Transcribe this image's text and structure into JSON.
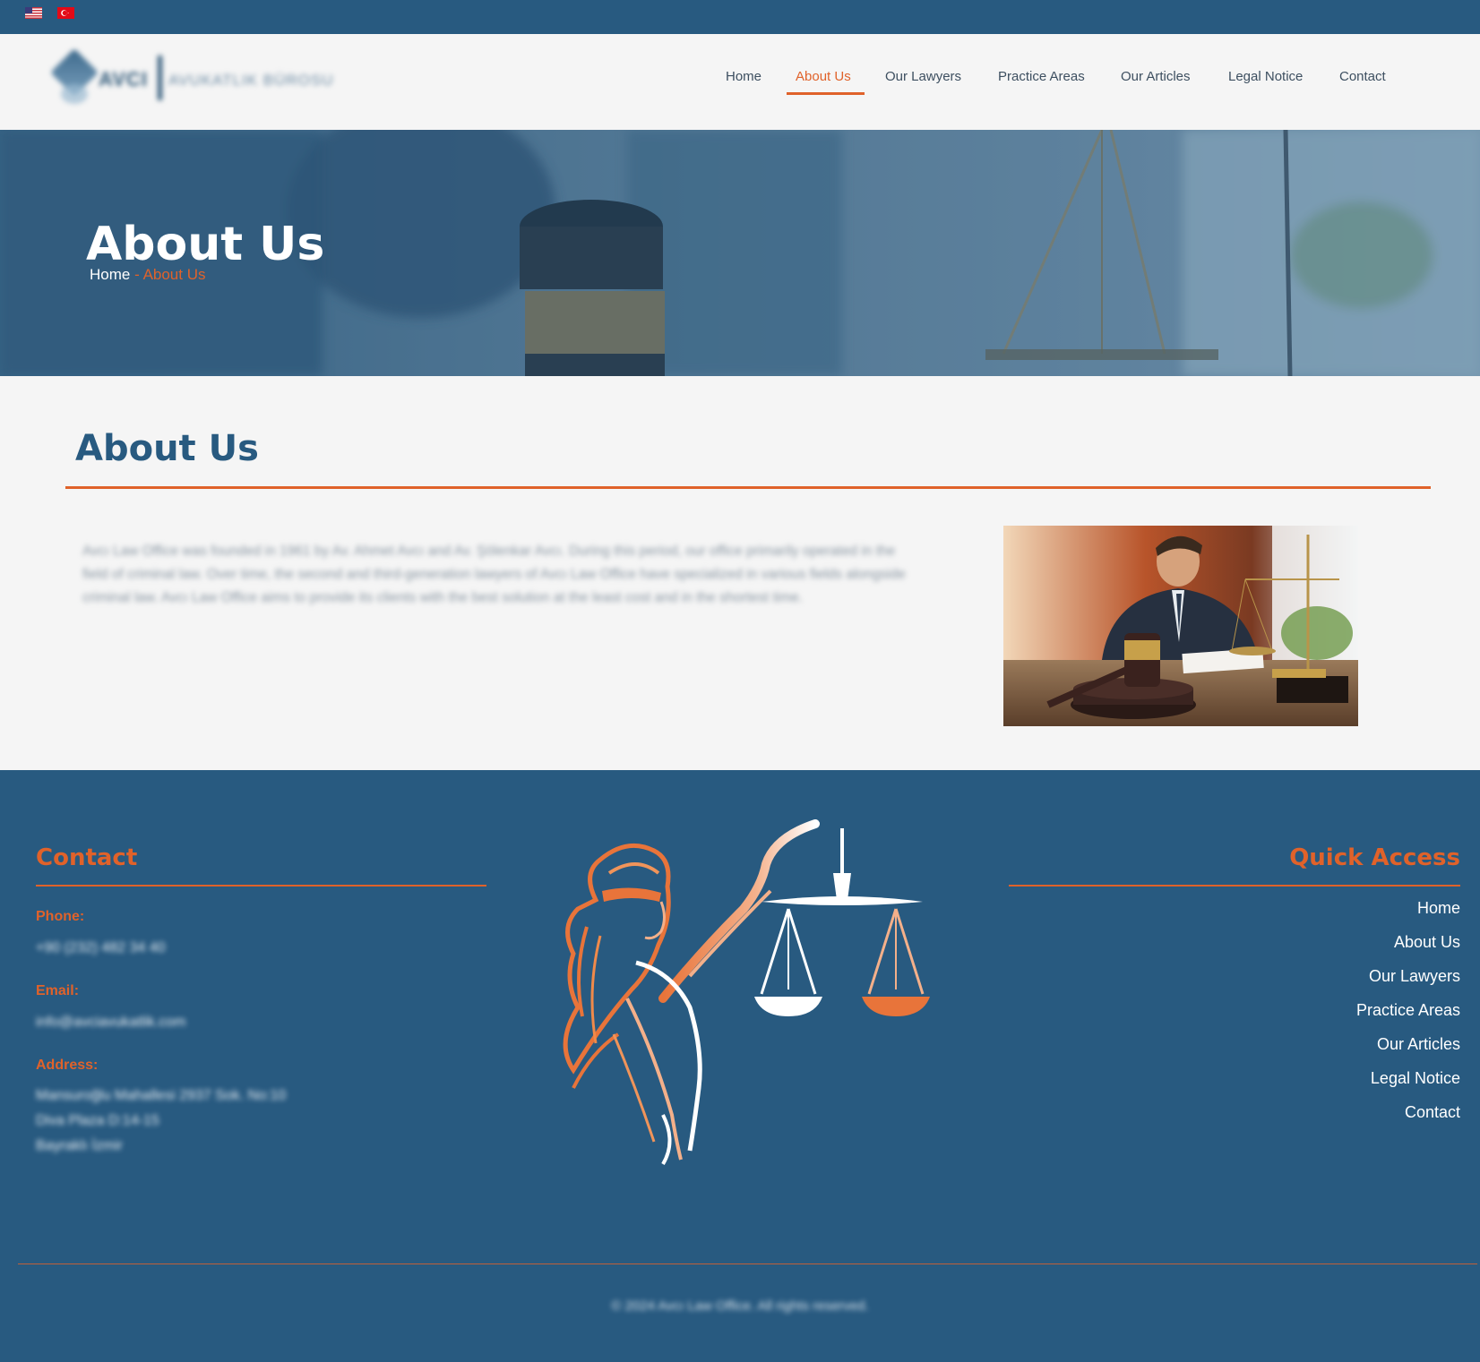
{
  "topbar": {
    "languages": [
      {
        "name": "us-flag-icon"
      },
      {
        "name": "tr-flag-icon"
      }
    ]
  },
  "header": {
    "logo_text": "AVCI",
    "logo_subtext": "AVUKATLIK BÜROSU"
  },
  "nav": {
    "items": [
      {
        "label": "Home"
      },
      {
        "label": "About Us",
        "active": true
      },
      {
        "label": "Our Lawyers"
      },
      {
        "label": "Practice Areas"
      },
      {
        "label": "Our Articles"
      },
      {
        "label": "Legal Notice"
      },
      {
        "label": "Contact"
      }
    ]
  },
  "hero": {
    "title": "About Us",
    "breadcrumb": {
      "home": "Home",
      "separator": "-",
      "current": "About Us"
    }
  },
  "about": {
    "title": "About Us",
    "text": "Avcı Law Office was founded in 1961 by Av. Ahmet Avcı and Av. Şölenkar Avcı. During this period, our office primarily operated in the field of criminal law. Over time, the second and third-generation lawyers of Avcı Law Office have specialized in various fields alongside criminal law. Avcı Law Office aims to provide its clients with the best solution at the least cost and in the shortest time."
  },
  "footer": {
    "contact": {
      "title": "Contact",
      "phone_label": "Phone:",
      "phone": "+90 (232) 482 34 40",
      "email_label": "Email:",
      "email": "info@avciavukatlik.com",
      "address_label": "Address:",
      "address_lines": [
        "Mansuroğlu Mahallesi 2937 Sok. No:10",
        "Diva Plaza D:14-15",
        "Bayraklı İzmir"
      ]
    },
    "quick_access": {
      "title": "Quick Access",
      "links": [
        "Home",
        "About Us",
        "Our Lawyers",
        "Practice Areas",
        "Our Articles",
        "Legal Notice",
        "Contact"
      ]
    },
    "copyright": "© 2024 Avcı Law Office. All rights reserved."
  },
  "colors": {
    "primary": "#285a80",
    "accent": "#e0622a",
    "background": "#f5f5f5"
  }
}
